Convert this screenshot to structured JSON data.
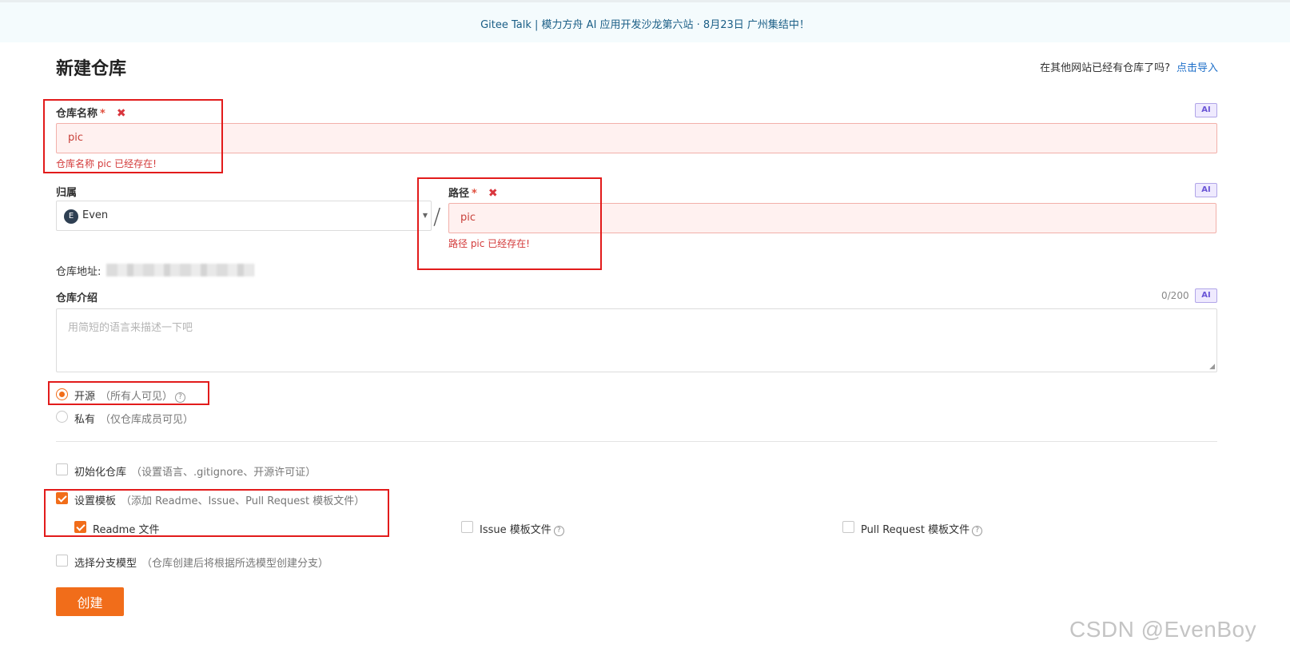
{
  "banner": {
    "text": "Gitee Talk | 模力方舟 AI 应用开发沙龙第六站 · 8月23日 广州集结中！"
  },
  "header": {
    "title": "新建仓库",
    "import_hint": "在其他网站已经有仓库了吗?",
    "import_link": "点击导入"
  },
  "repo_name": {
    "label": "仓库名称",
    "required": "*",
    "error_mark": "✖",
    "value": "pic",
    "error": "仓库名称 pic 已经存在!",
    "ai": "AI"
  },
  "owner": {
    "label": "归属",
    "avatar_letter": "E",
    "value": "Even",
    "separator": "/"
  },
  "path": {
    "label": "路径",
    "required": "*",
    "error_mark": "✖",
    "value": "pic",
    "error": "路径 pic 已经存在!",
    "ai": "AI"
  },
  "address": {
    "label": "仓库地址:"
  },
  "description": {
    "label": "仓库介绍",
    "counter": "0/200",
    "ai": "AI",
    "placeholder": "用简短的语言来描述一下吧"
  },
  "visibility": {
    "public_label": "开源",
    "public_sub": "（所有人可见）",
    "private_label": "私有",
    "private_sub": "（仅仓库成员可见）",
    "selected": "public"
  },
  "options": {
    "init_label": "初始化仓库",
    "init_sub": "（设置语言、.gitignore、开源许可证）",
    "init_checked": false,
    "template_label": "设置模板",
    "template_sub": "（添加 Readme、Issue、Pull Request 模板文件）",
    "template_checked": true,
    "readme_label": "Readme 文件",
    "readme_checked": true,
    "issue_label": "Issue 模板文件",
    "issue_checked": false,
    "pr_label": "Pull Request 模板文件",
    "pr_checked": false,
    "branch_label": "选择分支模型",
    "branch_sub": "（仓库创建后将根据所选模型创建分支）",
    "branch_checked": false
  },
  "submit": {
    "label": "创建"
  },
  "icons": {
    "help": "?",
    "help_icon": "question-circle-icon",
    "caret_icon": "caret-down-icon"
  },
  "colors": {
    "accent": "#f16d1a",
    "error": "#d33a3a",
    "link": "#1e6fc9",
    "annotation": "#e21b1b"
  },
  "watermark": "CSDN @EvenBoy"
}
